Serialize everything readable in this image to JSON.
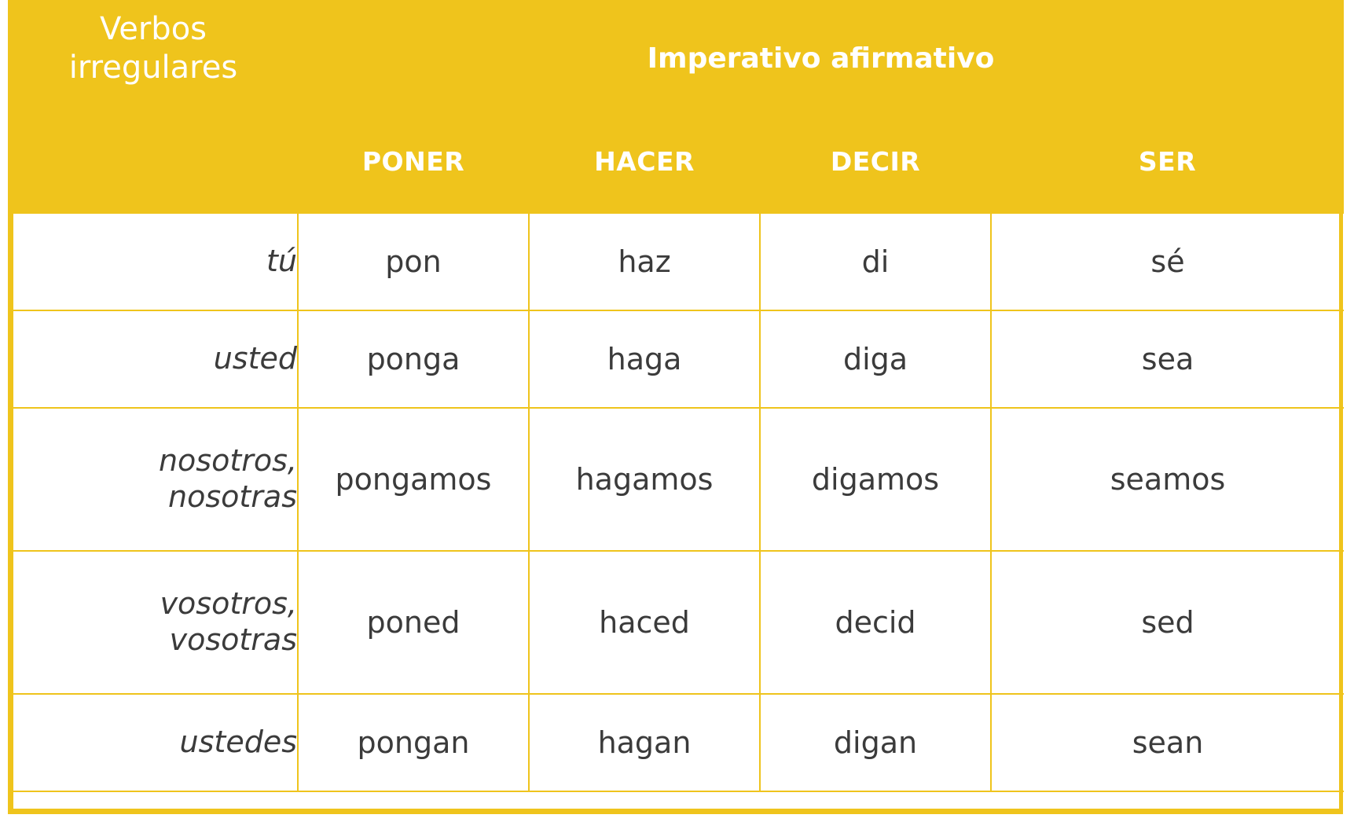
{
  "header": {
    "row_label_title": "Verbos\nirregulares",
    "row_label_title_line1": "Verbos",
    "row_label_title_line2": "irregulares",
    "mood_title": "Imperativo afirmativo",
    "verbs": [
      "PONER",
      "HACER",
      "DECIR",
      "SER"
    ]
  },
  "colors": {
    "header_background": "#EFC41C",
    "border": "#EFC41C",
    "header_text": "#FFFFFF",
    "body_text": "#3B3B3B",
    "page_background": "#FFFFFF"
  },
  "table": {
    "column_headers": [
      "",
      "PONER",
      "HACER",
      "DECIR",
      "SER"
    ],
    "rows": [
      {
        "pronoun": "tú",
        "pronoun_line1": "tú",
        "pronoun_line2": "",
        "forms": [
          "pon",
          "haz",
          "di",
          "sé"
        ]
      },
      {
        "pronoun": "usted",
        "pronoun_line1": "usted",
        "pronoun_line2": "",
        "forms": [
          "ponga",
          "haga",
          "diga",
          "sea"
        ]
      },
      {
        "pronoun": "nosotros, nosotras",
        "pronoun_line1": "nosotros,",
        "pronoun_line2": "nosotras",
        "forms": [
          "pongamos",
          "hagamos",
          "digamos",
          "seamos"
        ]
      },
      {
        "pronoun": "vosotros, vosotras",
        "pronoun_line1": "vosotros,",
        "pronoun_line2": "vosotras",
        "forms": [
          "poned",
          "haced",
          "decid",
          "sed"
        ]
      },
      {
        "pronoun": "ustedes",
        "pronoun_line1": "ustedes",
        "pronoun_line2": "",
        "forms": [
          "pongan",
          "hagan",
          "digan",
          "sean"
        ]
      }
    ]
  }
}
